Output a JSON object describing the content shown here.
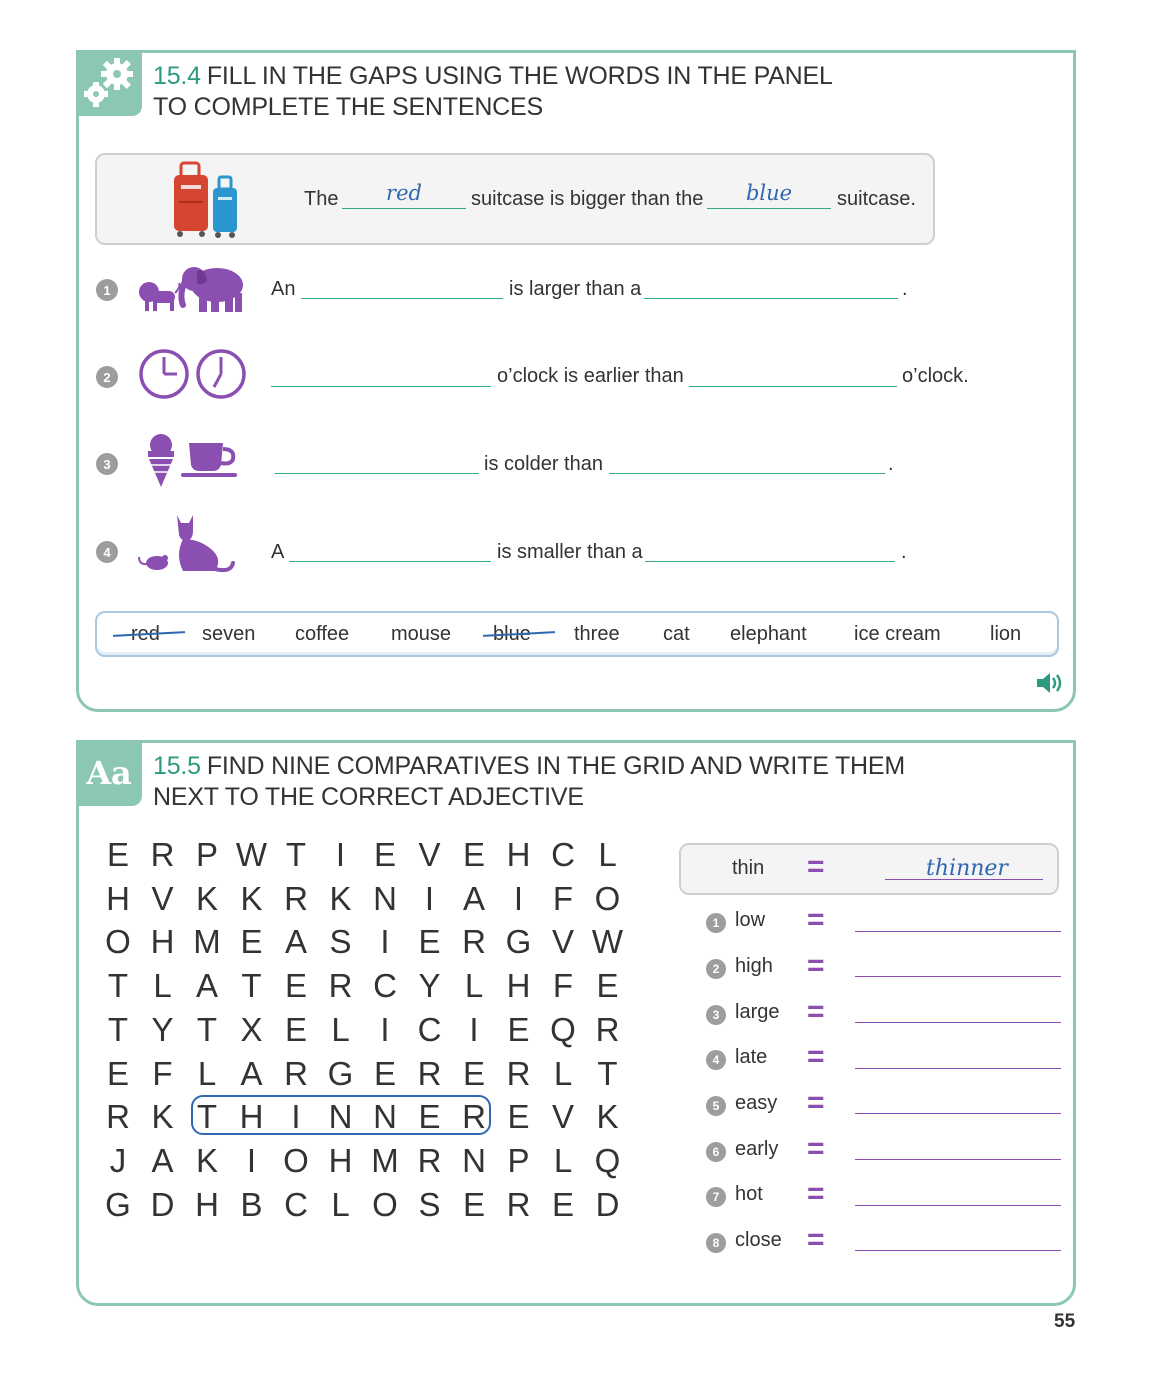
{
  "ex1": {
    "number": "15.4",
    "title_line1": "FILL IN THE GAPS USING THE WORDS IN THE PANEL",
    "title_line2": "TO COMPLETE THE SENTENCES",
    "example": {
      "w1": "The",
      "a1": "red",
      "w2": "suitcase is bigger than the",
      "a2": "blue",
      "w3": "suitcase."
    },
    "items": [
      {
        "num": "1",
        "p1": "An",
        "p2": "is larger than a",
        "p3": "."
      },
      {
        "num": "2",
        "p1": "",
        "p2": "o’clock is earlier than",
        "p3": "o’clock."
      },
      {
        "num": "3",
        "p1": "",
        "p2": "is colder than",
        "p3": "."
      },
      {
        "num": "4",
        "p1": "A",
        "p2": "is smaller than a",
        "p3": "."
      }
    ],
    "word_bank": [
      "red",
      "seven",
      "coffee",
      "mouse",
      "blue",
      "three",
      "cat",
      "elephant",
      "ice cream",
      "lion"
    ]
  },
  "ex2": {
    "number": "15.5",
    "badge": "Aa",
    "title_line1": "FIND NINE COMPARATIVES IN THE GRID AND WRITE THEM",
    "title_line2": "NEXT TO THE CORRECT ADJECTIVE",
    "grid": [
      [
        "E",
        "R",
        "P",
        "W",
        "T",
        "I",
        "E",
        "V",
        "E",
        "H",
        "C",
        "L"
      ],
      [
        "H",
        "V",
        "K",
        "K",
        "R",
        "K",
        "N",
        "I",
        "A",
        "I",
        "F",
        "O"
      ],
      [
        "O",
        "H",
        "M",
        "E",
        "A",
        "S",
        "I",
        "E",
        "R",
        "G",
        "V",
        "W"
      ],
      [
        "T",
        "L",
        "A",
        "T",
        "E",
        "R",
        "C",
        "Y",
        "L",
        "H",
        "F",
        "E"
      ],
      [
        "T",
        "Y",
        "T",
        "X",
        "E",
        "L",
        "I",
        "C",
        "I",
        "E",
        "Q",
        "R"
      ],
      [
        "E",
        "F",
        "L",
        "A",
        "R",
        "G",
        "E",
        "R",
        "E",
        "R",
        "L",
        "T"
      ],
      [
        "R",
        "K",
        "T",
        "H",
        "I",
        "N",
        "N",
        "E",
        "R",
        "E",
        "V",
        "K"
      ],
      [
        "J",
        "A",
        "K",
        "I",
        "O",
        "H",
        "M",
        "R",
        "N",
        "P",
        "L",
        "Q"
      ],
      [
        "G",
        "D",
        "H",
        "B",
        "C",
        "L",
        "O",
        "S",
        "E",
        "R",
        "E",
        "D"
      ]
    ],
    "example": {
      "adjective": "thin",
      "equals": "=",
      "answer": "thinner"
    },
    "items": [
      {
        "num": "1",
        "adjective": "low"
      },
      {
        "num": "2",
        "adjective": "high"
      },
      {
        "num": "3",
        "adjective": "large"
      },
      {
        "num": "4",
        "adjective": "late"
      },
      {
        "num": "5",
        "adjective": "easy"
      },
      {
        "num": "6",
        "adjective": "early"
      },
      {
        "num": "7",
        "adjective": "hot"
      },
      {
        "num": "8",
        "adjective": "close"
      }
    ],
    "equals": "="
  },
  "page_number": "55",
  "colors": {
    "accent": "#8cc6b4",
    "title_number": "#2c9a7e",
    "handwriting": "#2f68b0",
    "purple": "#8a4fb0",
    "gap_line": "#2fa88c"
  },
  "icons": [
    "gear-icon",
    "suitcase-icon",
    "lion-icon",
    "elephant-icon",
    "clock-icon",
    "ice-cream-icon",
    "coffee-cup-icon",
    "mouse-icon",
    "cat-icon",
    "audio-speaker-icon"
  ]
}
